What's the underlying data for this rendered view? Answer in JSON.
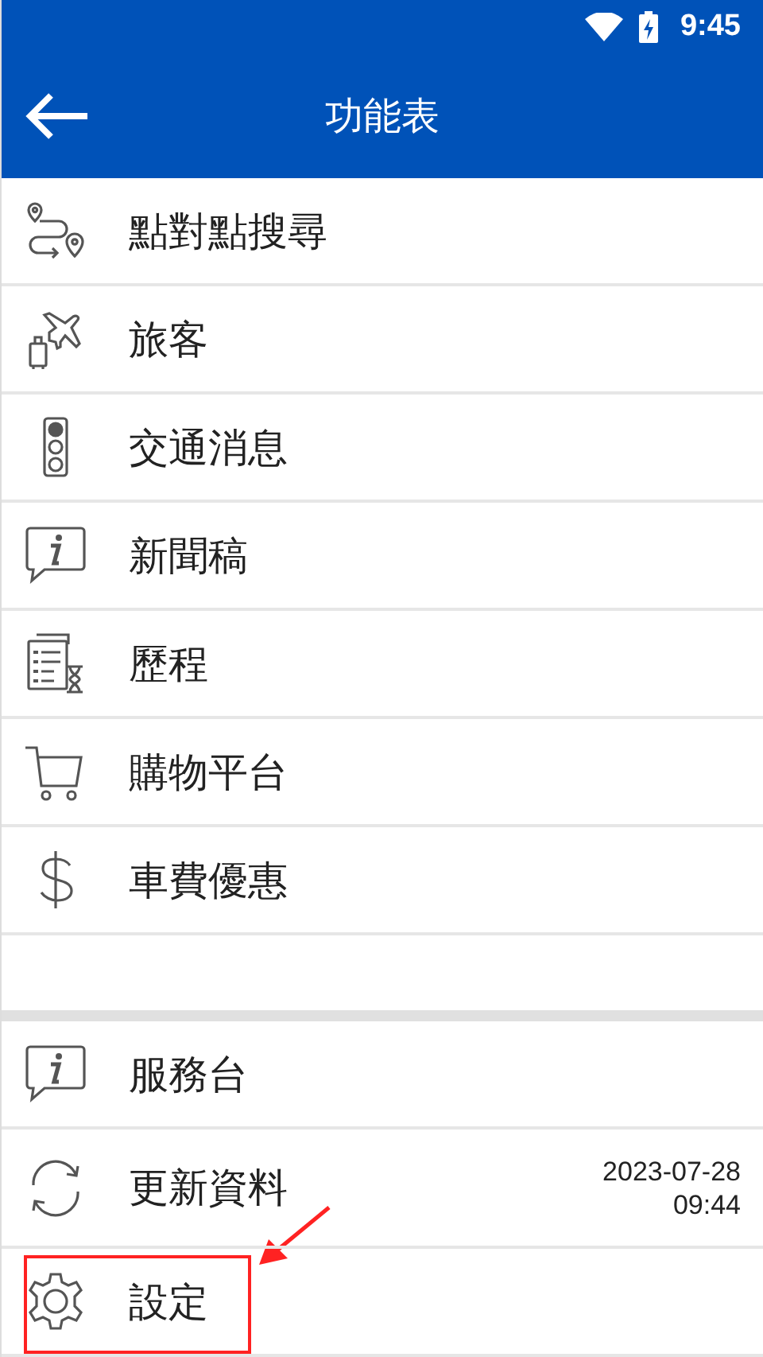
{
  "status_bar": {
    "time": "9:45"
  },
  "toolbar": {
    "title": "功能表"
  },
  "sections": [
    {
      "items": [
        {
          "kind": "route",
          "label": "點對點搜尋",
          "highlighted": false
        },
        {
          "kind": "travel",
          "label": "旅客",
          "highlighted": false
        },
        {
          "kind": "traffic",
          "label": "交通消息",
          "highlighted": false
        },
        {
          "kind": "news",
          "label": "新聞稿",
          "highlighted": false
        },
        {
          "kind": "history",
          "label": "歷程",
          "highlighted": false
        },
        {
          "kind": "shopping",
          "label": "購物平台",
          "highlighted": false
        },
        {
          "kind": "fares",
          "label": "車費優惠",
          "highlighted": false
        }
      ]
    },
    {
      "items": [
        {
          "kind": "help",
          "label": "服務台",
          "highlighted": false
        },
        {
          "kind": "update",
          "label": "更新資料",
          "detail": [
            "2023-07-28",
            "09:44"
          ],
          "highlighted": false
        },
        {
          "kind": "settings",
          "label": "設定",
          "highlighted": true
        }
      ]
    }
  ]
}
